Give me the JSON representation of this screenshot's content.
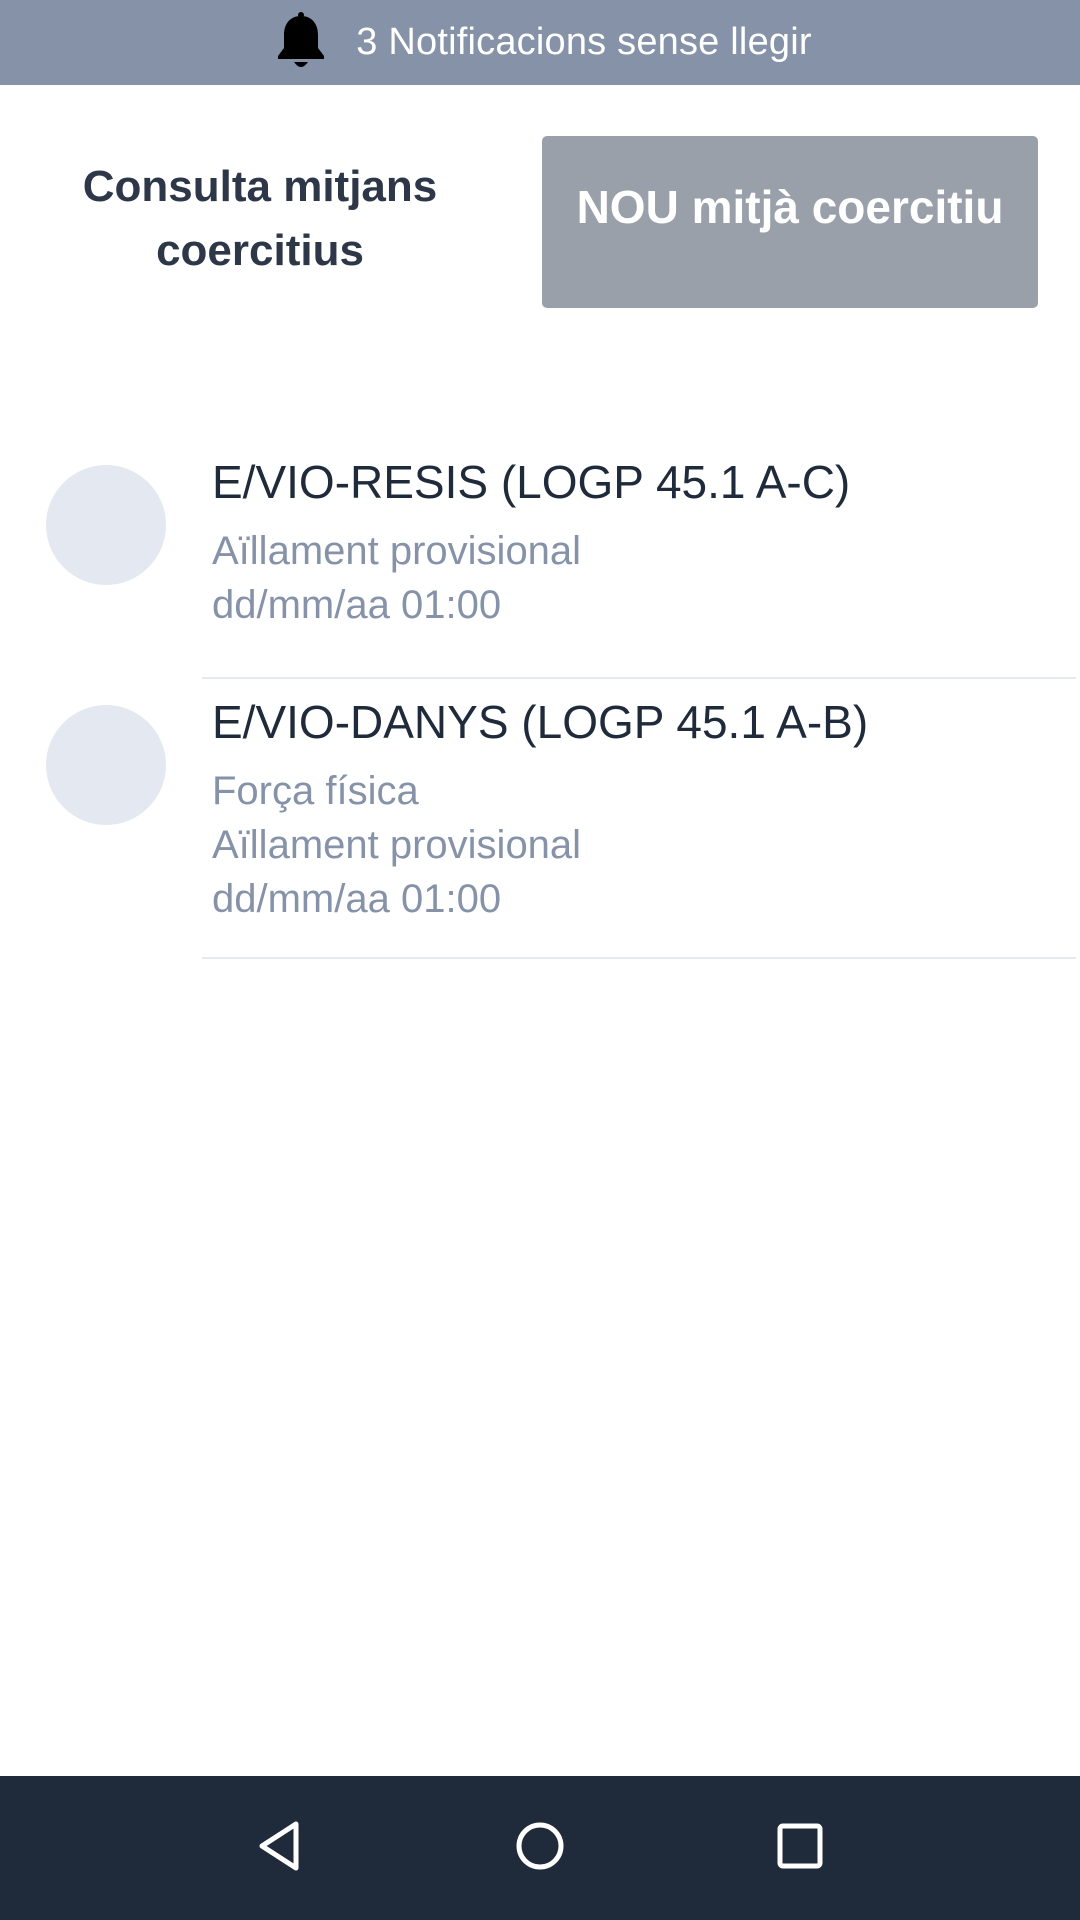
{
  "notification_bar": {
    "icon": "bell-icon",
    "text": "3 Notificacions sense llegir"
  },
  "header": {
    "title": "Consulta mitjans coercitius",
    "new_button_label": "NOU mitjà coercitiu"
  },
  "records": [
    {
      "title": "E/VIO-RESIS (LOGP 45.1 A-C)",
      "lines": [
        "Aïllament provisional",
        "dd/mm/aa 01:00"
      ]
    },
    {
      "title": "E/VIO-DANYS (LOGP 45.1 A-B)",
      "lines": [
        "Força física",
        "Aïllament provisional",
        "dd/mm/aa 01:00"
      ]
    }
  ],
  "nav_bar": {
    "back_icon": "back-triangle-icon",
    "home_icon": "home-circle-icon",
    "recents_icon": "recents-square-icon"
  },
  "colors": {
    "notification_bg": "#8592a8",
    "button_bg": "#9aa0aa",
    "title_text": "#2d3748",
    "secondary_text": "#8592a8",
    "avatar_bg": "#e4e8f0",
    "nav_bg": "#1f2a3b"
  }
}
